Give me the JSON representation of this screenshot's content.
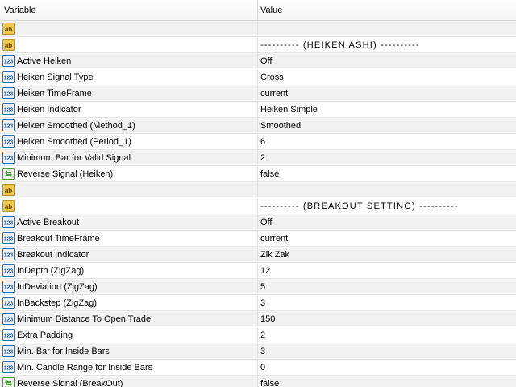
{
  "header": {
    "variable": "Variable",
    "value": "Value"
  },
  "rows": [
    {
      "type": "string",
      "label": "",
      "value": "",
      "separator": false
    },
    {
      "type": "string",
      "label": "",
      "value": "---------- (HEIKEN ASHI) ----------",
      "separator": true
    },
    {
      "type": "number",
      "label": "Active Heiken",
      "value": "Off",
      "separator": false
    },
    {
      "type": "number",
      "label": "Heiken Signal Type",
      "value": "Cross",
      "separator": false
    },
    {
      "type": "number",
      "label": "Heiken TimeFrame",
      "value": "current",
      "separator": false
    },
    {
      "type": "number",
      "label": "Heiken Indicator",
      "value": "Heiken Simple",
      "separator": false
    },
    {
      "type": "number",
      "label": "Heiken Smoothed (Method_1)",
      "value": "Smoothed",
      "separator": false
    },
    {
      "type": "number",
      "label": "Heiken Smoothed (Period_1)",
      "value": "6",
      "separator": false
    },
    {
      "type": "number",
      "label": "Minimum Bar for Valid Signal",
      "value": "2",
      "separator": false
    },
    {
      "type": "bool",
      "label": "Reverse Signal  (Heiken)",
      "value": "false",
      "separator": false
    },
    {
      "type": "string",
      "label": "",
      "value": "",
      "separator": false
    },
    {
      "type": "string",
      "label": "",
      "value": "---------- (BREAKOUT SETTING) ----------",
      "separator": true
    },
    {
      "type": "number",
      "label": "Active Breakout",
      "value": "Off",
      "separator": false
    },
    {
      "type": "number",
      "label": "Breakout TimeFrame",
      "value": "current",
      "separator": false
    },
    {
      "type": "number",
      "label": "Breakout Indicator",
      "value": "Zik Zak",
      "separator": false
    },
    {
      "type": "number",
      "label": "InDepth (ZigZag)",
      "value": "12",
      "separator": false
    },
    {
      "type": "number",
      "label": "InDeviation (ZigZag)",
      "value": "5",
      "separator": false
    },
    {
      "type": "number",
      "label": "InBackstep (ZigZag)",
      "value": "3",
      "separator": false
    },
    {
      "type": "number",
      "label": "Minimum Distance To Open Trade",
      "value": "150",
      "separator": false
    },
    {
      "type": "number",
      "label": "Extra Padding",
      "value": "2",
      "separator": false
    },
    {
      "type": "number",
      "label": "Min. Bar for Inside Bars",
      "value": "3",
      "separator": false
    },
    {
      "type": "number",
      "label": "Min. Candle Range for Inside Bars",
      "value": "0",
      "separator": false
    },
    {
      "type": "bool",
      "label": "Reverse Signal  (BreakOut)",
      "value": "false",
      "separator": false
    }
  ],
  "icons": {
    "string": "string-param-icon",
    "number": "number-param-icon",
    "bool": "bool-param-icon"
  },
  "colors": {
    "header_border": "#d5d5d5",
    "row_odd": "#f2f2f2",
    "row_even": "#ffffff",
    "icon_blue": "#2a6fb5",
    "icon_yellow": "#f0c94a",
    "icon_green": "#4a9a3a"
  }
}
